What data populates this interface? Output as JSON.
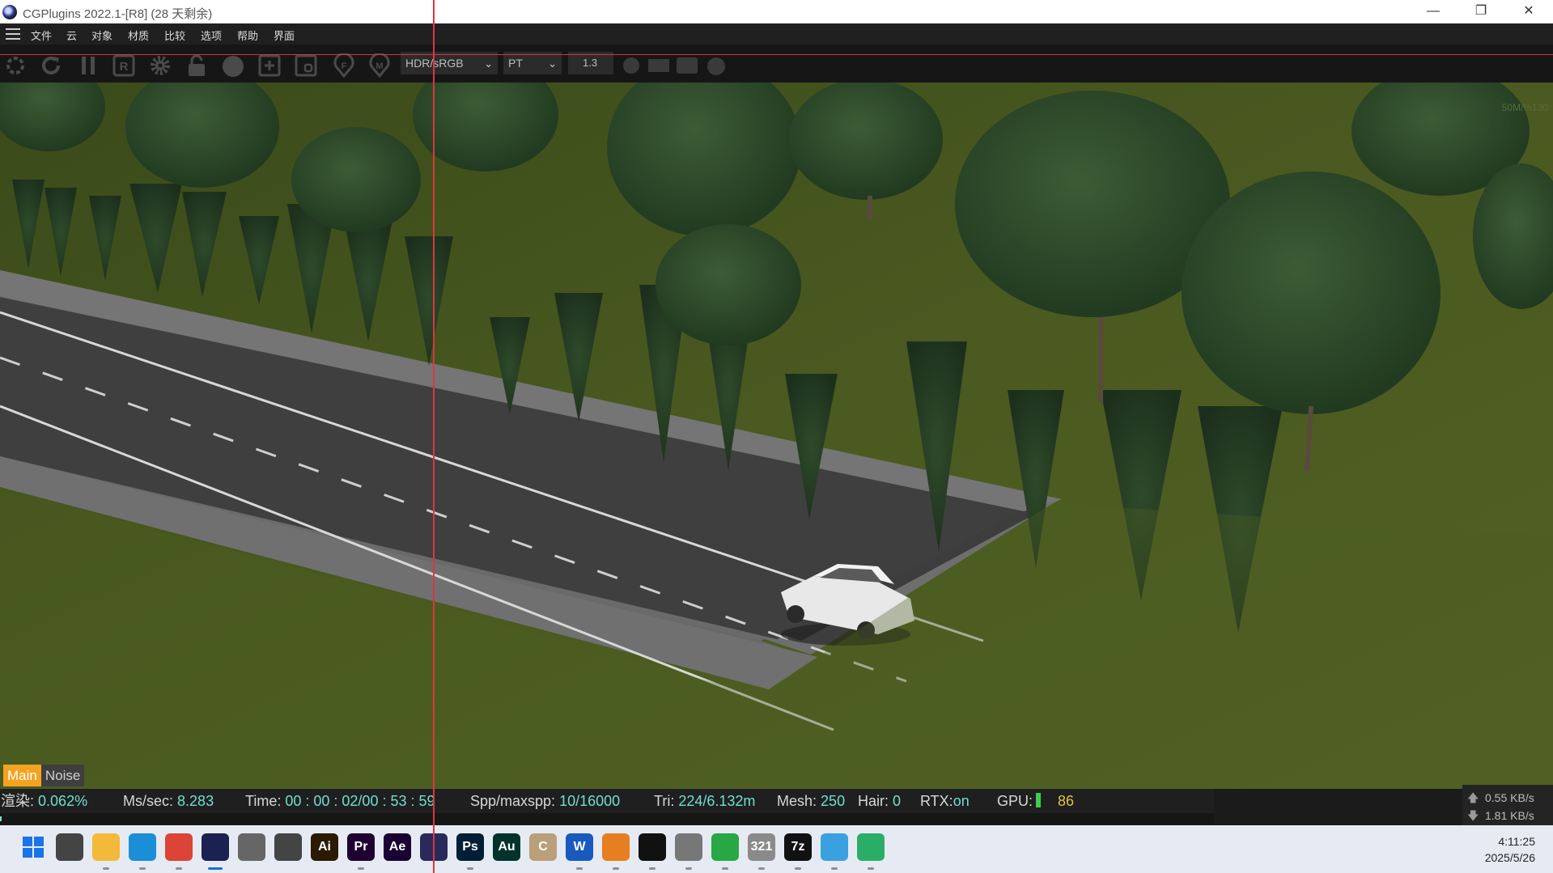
{
  "window": {
    "title": "CGPlugins   2022.1-[R8] (28 天剩余)",
    "controls": {
      "minimize": "—",
      "maximize": "❐",
      "close": "✕"
    }
  },
  "menu": [
    "文件",
    "云",
    "对象",
    "材质",
    "比较",
    "选项",
    "帮助",
    "界面"
  ],
  "toolbar": {
    "icons": [
      "render-start-icon",
      "refresh-icon",
      "pause-icon",
      "region-render-icon",
      "settings-gear-icon",
      "lock-icon",
      "material-sphere-icon",
      "add-node-icon",
      "camera-frame-icon",
      "focus-pick-icon",
      "material-pick-icon"
    ],
    "color_space": "HDR/sRGB",
    "kernel": "PT",
    "value": "1.3"
  },
  "viewport": {
    "corner_text": "50M/%130"
  },
  "channels": {
    "main": "Main",
    "noise": "Noise"
  },
  "status": {
    "render_label": "渲染:",
    "render_value": "0.062%",
    "ms_label": "Ms/sec:",
    "ms_value": "8.283",
    "time_label": "Time:",
    "time_value": "00 : 00 : 02/00 : 53 : 59",
    "spp_label": "Spp/maxspp:",
    "spp_value": "10/16000",
    "tri_label": "Tri:",
    "tri_value": "224/6.132m",
    "mesh_label": "Mesh:",
    "mesh_value": "250",
    "hair_label": "Hair:",
    "hair_value": "0",
    "rtx_label": "RTX:",
    "rtx_value": "on",
    "gpu_label": "GPU:",
    "gpu_value": "86",
    "progress": 0.00062
  },
  "network": {
    "up": "0.55 KB/s",
    "down": "1.81 KB/s",
    "up_arrow": "🡅",
    "down_arrow": "🡇"
  },
  "taskbar": {
    "apps": [
      {
        "name": "start-button",
        "label": "",
        "color": "#1a73e8"
      },
      {
        "name": "task-view-icon",
        "label": "",
        "color": "#444"
      },
      {
        "name": "file-explorer-icon",
        "label": "",
        "color": "#f3b93a"
      },
      {
        "name": "edge-icon",
        "label": "",
        "color": "#1b8fd6"
      },
      {
        "name": "chrome-icon",
        "label": "",
        "color": "#db4437"
      },
      {
        "name": "cinema4d-icon",
        "label": "",
        "color": "#1b2150"
      },
      {
        "name": "alien-app-icon",
        "label": "",
        "color": "#666"
      },
      {
        "name": "twitch-like-icon",
        "label": "",
        "color": "#444"
      },
      {
        "name": "illustrator-icon",
        "label": "Ai",
        "color": "#2a1a00"
      },
      {
        "name": "premiere-icon",
        "label": "Pr",
        "color": "#1f0033"
      },
      {
        "name": "after-effects-icon",
        "label": "Ae",
        "color": "#1a0033"
      },
      {
        "name": "vs-icon",
        "label": "",
        "color": "#2a2a5a"
      },
      {
        "name": "photoshop-icon",
        "label": "Ps",
        "color": "#001e36"
      },
      {
        "name": "audition-icon",
        "label": "Au",
        "color": "#00332b"
      },
      {
        "name": "c-app-icon",
        "label": "C",
        "color": "#b9a07a"
      },
      {
        "name": "word-icon",
        "label": "W",
        "color": "#185abd"
      },
      {
        "name": "search-tool-icon",
        "label": "",
        "color": "#e67e22"
      },
      {
        "name": "terminal-icon",
        "label": "",
        "color": "#111"
      },
      {
        "name": "card-reader-icon",
        "label": "",
        "color": "#777"
      },
      {
        "name": "remote-desktop-icon",
        "label": "",
        "color": "#28a745"
      },
      {
        "name": "calendar-app-icon",
        "label": "321",
        "color": "#8a8a8a"
      },
      {
        "name": "7zip-icon",
        "label": "7z",
        "color": "#111"
      },
      {
        "name": "cloud-app-icon",
        "label": "",
        "color": "#3aa0e0"
      },
      {
        "name": "wechat-icon",
        "label": "",
        "color": "#2aae67"
      }
    ],
    "time": "4:11:25",
    "date": "2025/5/26"
  }
}
